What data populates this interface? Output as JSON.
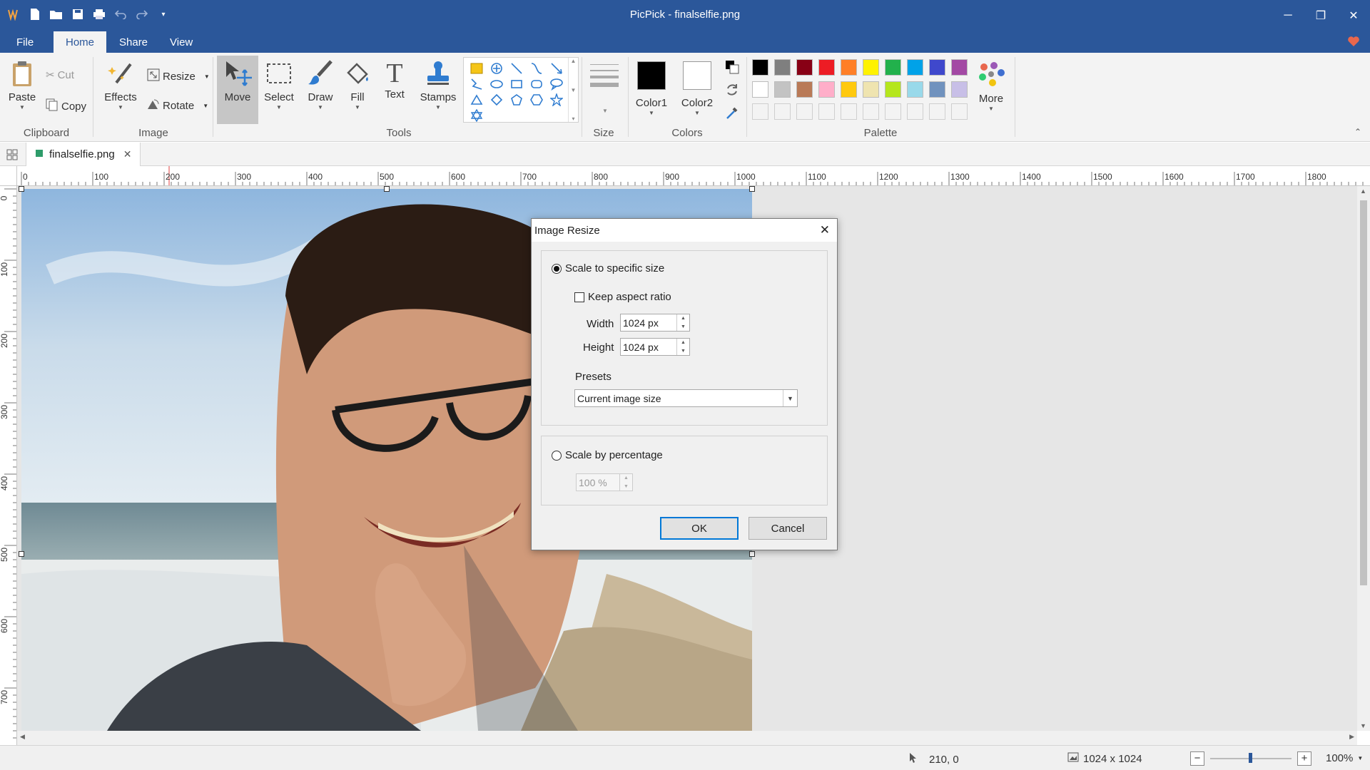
{
  "window": {
    "title": "PicPick - finalselfie.png"
  },
  "menu": {
    "file": "File",
    "home": "Home",
    "share": "Share",
    "view": "View"
  },
  "ribbon": {
    "clipboard": {
      "paste": "Paste",
      "cut": "Cut",
      "copy": "Copy",
      "group": "Clipboard"
    },
    "image": {
      "effects": "Effects",
      "resize": "Resize",
      "rotate": "Rotate",
      "group": "Image"
    },
    "tools": {
      "move": "Move",
      "select": "Select",
      "draw": "Draw",
      "fill": "Fill",
      "text": "Text",
      "stamps": "Stamps",
      "group": "Tools"
    },
    "size": {
      "group": "Size"
    },
    "colors": {
      "color1": "Color1",
      "color2": "Color2",
      "group": "Colors",
      "color1_value": "#000000",
      "color2_value": "#ffffff"
    },
    "palette": {
      "group": "Palette",
      "more": "More",
      "row1": [
        "#000000",
        "#7f7f7f",
        "#880015",
        "#ed1c24",
        "#ff7f27",
        "#fff200",
        "#22b14c",
        "#00a2e8",
        "#3f48cc",
        "#a349a4"
      ],
      "row2": [
        "#ffffff",
        "#c3c3c3",
        "#b97a57",
        "#ffaec9",
        "#ffc90e",
        "#efe4b0",
        "#b5e61d",
        "#99d9ea",
        "#7092be",
        "#c8bfe7"
      ]
    }
  },
  "document": {
    "tab_name": "finalselfie.png"
  },
  "rulers": {
    "horizontal": [
      "0",
      "100",
      "200",
      "300",
      "400",
      "500",
      "600",
      "700",
      "800",
      "900",
      "1000",
      "1100",
      "1200",
      "1300",
      "1400",
      "1500",
      "1600",
      "1700",
      "1800"
    ],
    "vertical": [
      "0",
      "100",
      "200",
      "300",
      "400",
      "500",
      "600",
      "700"
    ]
  },
  "dialog": {
    "title": "Image Resize",
    "scale_specific": "Scale to specific size",
    "keep_aspect": "Keep aspect ratio",
    "width_label": "Width",
    "width_value": "1024 px",
    "height_label": "Height",
    "height_value": "1024 px",
    "presets_label": "Presets",
    "presets_value": "Current image size",
    "scale_percentage": "Scale by percentage",
    "percentage_value": "100 %",
    "ok": "OK",
    "cancel": "Cancel"
  },
  "status": {
    "cursor": "210, 0",
    "image_size": "1024 x 1024",
    "zoom": "100%"
  }
}
